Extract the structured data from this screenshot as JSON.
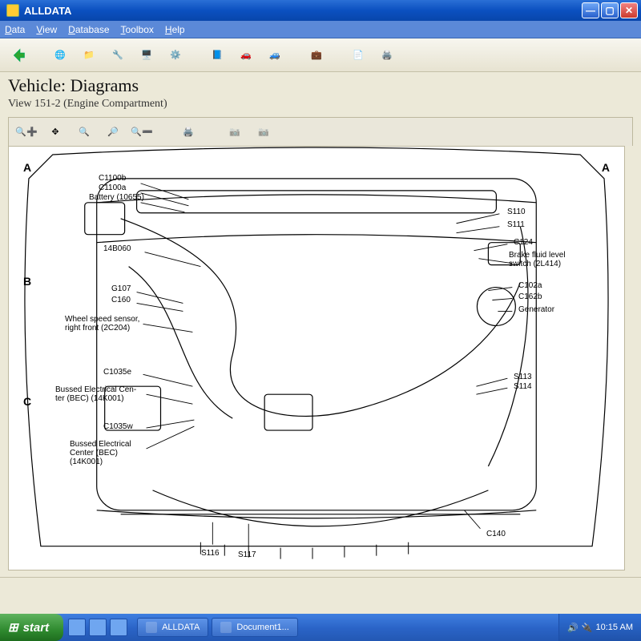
{
  "window": {
    "title": "ALLDATA"
  },
  "menubar": {
    "data": {
      "label": "Data",
      "accel": "D"
    },
    "view": {
      "label": "View",
      "accel": "V"
    },
    "database": {
      "label": "Database",
      "accel": "D"
    },
    "toolbox": {
      "label": "Toolbox",
      "accel": "T"
    },
    "help": {
      "label": "Help",
      "accel": "H"
    }
  },
  "heading": {
    "title": "Vehicle:  Diagrams",
    "subtitle": "View 151-2 (Engine Compartment)"
  },
  "viewer": {
    "rows": [
      "A",
      "B",
      "C"
    ],
    "row_right": "A",
    "annotations": {
      "left": [
        {
          "id": "c1100b",
          "line1": "C1100b"
        },
        {
          "id": "c1100a",
          "line1": "C1100a"
        },
        {
          "id": "battery",
          "line1": "Battery (10655)"
        },
        {
          "id": "14b060",
          "line1": "14B060"
        },
        {
          "id": "g107",
          "line1": "G107"
        },
        {
          "id": "c160",
          "line1": "C160"
        },
        {
          "id": "wheelspd",
          "line1": "Wheel speed sensor,",
          "line2": "right front (2C204)"
        },
        {
          "id": "c1035e",
          "line1": "C1035e"
        },
        {
          "id": "bec1",
          "line1": "Bussed Electrical Cen-",
          "line2": "ter (BEC) (14K001)"
        },
        {
          "id": "c1035w",
          "line1": "C1035w"
        },
        {
          "id": "bec2",
          "line1": "Bussed Electrical",
          "line2": "Center (BEC)",
          "line3": "(14K001)"
        }
      ],
      "right": [
        {
          "id": "s110",
          "line1": "S110"
        },
        {
          "id": "s111",
          "line1": "S111"
        },
        {
          "id": "c124",
          "line1": "C124"
        },
        {
          "id": "brake",
          "line1": "Brake fluid level",
          "line2": "switch (2L414)"
        },
        {
          "id": "c102a",
          "line1": "C102a"
        },
        {
          "id": "c162b",
          "line1": "C162b"
        },
        {
          "id": "gen",
          "line1": "Generator"
        },
        {
          "id": "s113",
          "line1": "S113"
        },
        {
          "id": "s114",
          "line1": "S114"
        }
      ],
      "bottom": [
        {
          "id": "s116",
          "line1": "S116"
        },
        {
          "id": "s117",
          "line1": "S117"
        },
        {
          "id": "c140",
          "line1": "C140"
        }
      ]
    }
  },
  "statusbar": {
    "left": "",
    "right": ""
  },
  "taskbar": {
    "start": "start",
    "tasks": [
      {
        "label": "ALLDATA"
      },
      {
        "label": "Document1..."
      }
    ],
    "clock": "10:15 AM"
  }
}
